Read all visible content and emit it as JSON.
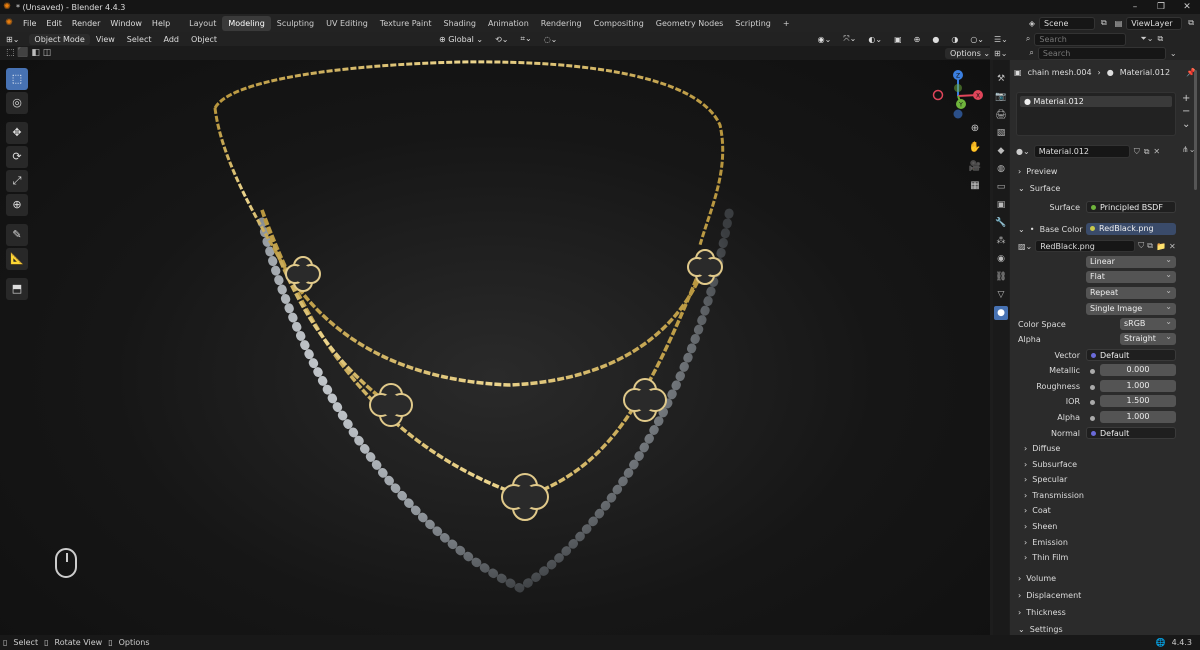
{
  "window": {
    "title": "* (Unsaved) - Blender 4.4.3",
    "controls": [
      "–",
      "❐",
      "✕"
    ]
  },
  "menu": [
    "File",
    "Edit",
    "Render",
    "Window",
    "Help"
  ],
  "workspaces": [
    "Layout",
    "Modeling",
    "Sculpting",
    "UV Editing",
    "Texture Paint",
    "Shading",
    "Animation",
    "Rendering",
    "Compositing",
    "Geometry Nodes",
    "Scripting"
  ],
  "active_workspace": "Modeling",
  "scene": "Scene",
  "view_layer": "ViewLayer",
  "viewport_header": {
    "mode": "Object Mode",
    "menus": [
      "View",
      "Select",
      "Add",
      "Object"
    ],
    "orientation": "Global",
    "options": "Options"
  },
  "search_placeholder": "Search",
  "breadcrumb": {
    "object": "chain mesh.004",
    "material": "Material.012"
  },
  "material_slot": "Material.012",
  "material_name": "Material.012",
  "panels": {
    "preview": "Preview",
    "surface": "Surface",
    "surface_label": "Surface",
    "surface_value": "Principled BSDF",
    "base_color_label": "Base Color",
    "base_color_value": "RedBlack.png",
    "image_name": "RedBlack.png",
    "interpolation": "Linear",
    "projection": "Flat",
    "extension": "Repeat",
    "source": "Single Image",
    "color_space_label": "Color Space",
    "color_space": "sRGB",
    "alpha_label": "Alpha",
    "alpha_mode": "Straight",
    "vector_label": "Vector",
    "vector_value": "Default",
    "metallic_label": "Metallic",
    "metallic": "0.000",
    "roughness_label": "Roughness",
    "roughness": "1.000",
    "ior_label": "IOR",
    "ior": "1.500",
    "alpha2_label": "Alpha",
    "alpha_value": "1.000",
    "normal_label": "Normal",
    "normal_value": "Default",
    "subpanels": [
      "Diffuse",
      "Subsurface",
      "Specular",
      "Transmission",
      "Coat",
      "Sheen",
      "Emission",
      "Thin Film"
    ],
    "bottom": [
      "Volume",
      "Displacement",
      "Thickness",
      "Settings"
    ]
  },
  "status": {
    "select": "Select",
    "rotate": "Rotate View",
    "options": "Options",
    "version": "4.4.3"
  },
  "colors": {
    "accent": "#4772b3",
    "gold": "#d8c07a",
    "pearl": "#cfd2d6",
    "gizmo_x": "#e0455a",
    "gizmo_y": "#6fb43c",
    "gizmo_z": "#3b7fe0"
  }
}
